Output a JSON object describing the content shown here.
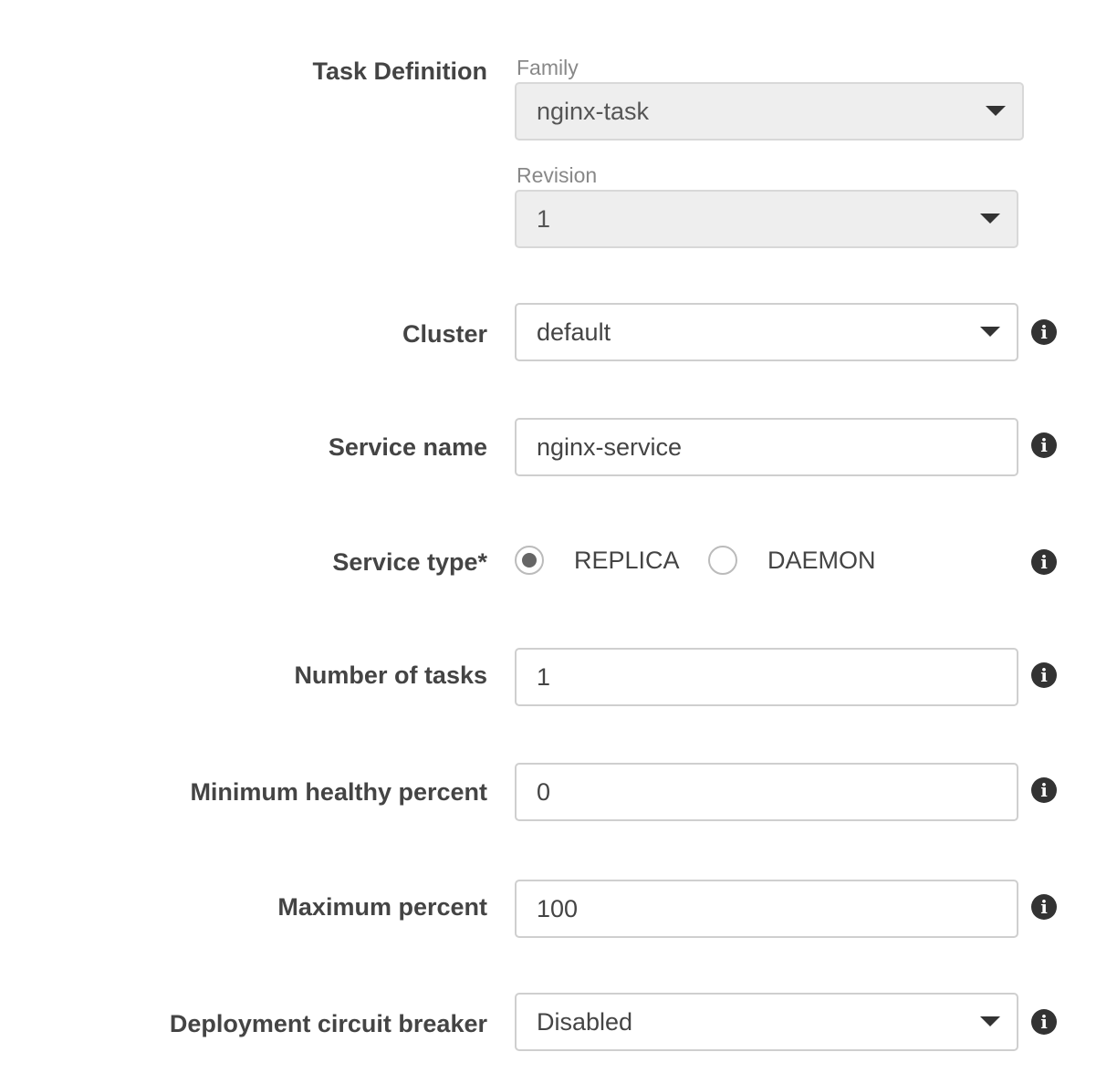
{
  "task_definition": {
    "label": "Task Definition",
    "family": {
      "label": "Family",
      "value": "nginx-task"
    },
    "revision": {
      "label": "Revision",
      "value": "1"
    }
  },
  "cluster": {
    "label": "Cluster",
    "value": "default",
    "icon": "info-icon"
  },
  "service_name": {
    "label": "Service name",
    "value": "nginx-service",
    "icon": "info-icon"
  },
  "service_type": {
    "label": "Service type*",
    "options": [
      "REPLICA",
      "DAEMON"
    ],
    "selected": "REPLICA",
    "icon": "info-icon"
  },
  "number_of_tasks": {
    "label": "Number of tasks",
    "value": "1",
    "icon": "info-icon"
  },
  "minimum_healthy_percent": {
    "label": "Minimum healthy percent",
    "value": "0",
    "icon": "info-icon"
  },
  "maximum_percent": {
    "label": "Maximum percent",
    "value": "100",
    "icon": "info-icon"
  },
  "deployment_circuit_breaker": {
    "label": "Deployment circuit breaker",
    "value": "Disabled",
    "icon": "info-icon"
  },
  "info_glyph": "i",
  "colors": {
    "label_text": "#444444",
    "sublabel_text": "#888888",
    "border": "#cfcfcf",
    "disabled_bg": "#eeeeee",
    "icon_bg": "#333333"
  }
}
